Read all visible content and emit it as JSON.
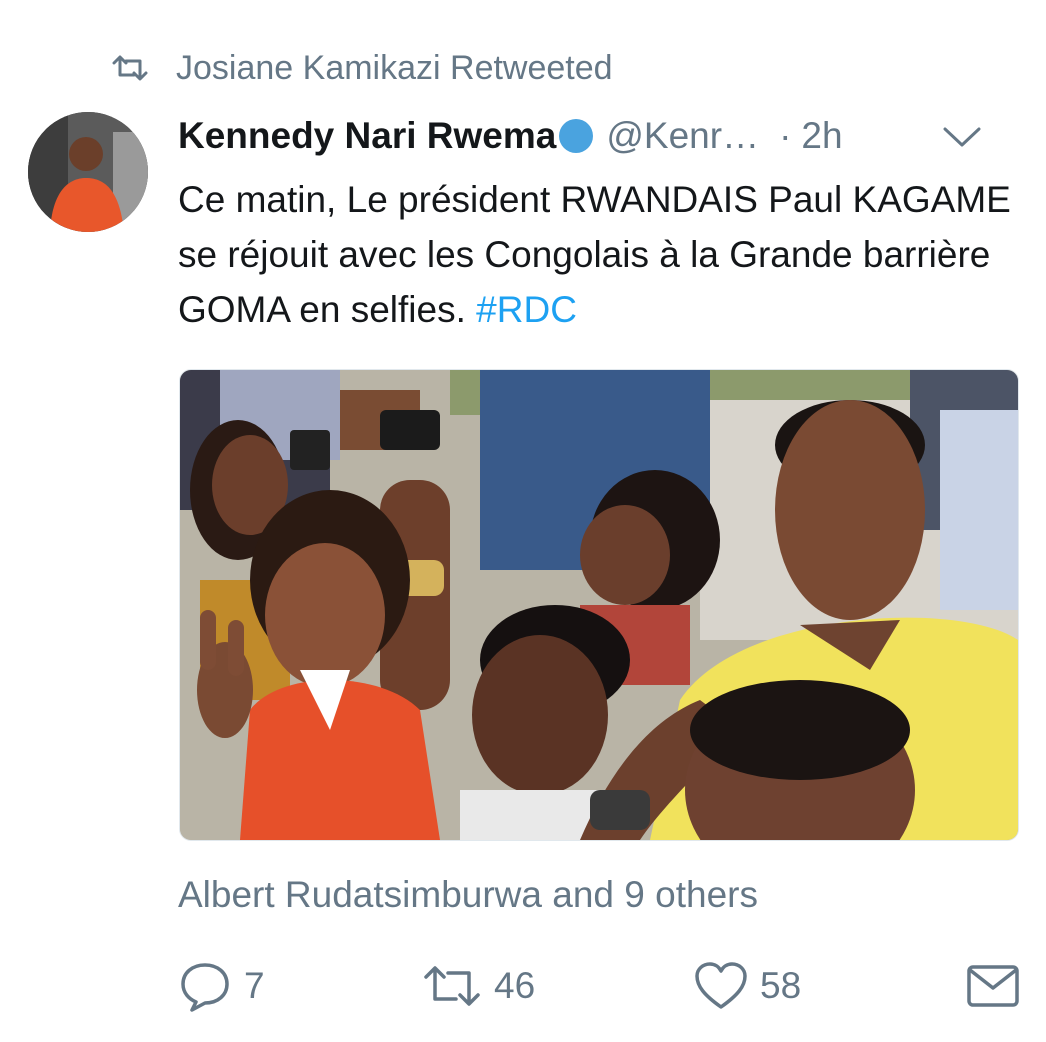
{
  "retweet_notice": {
    "icon": "retweet-icon",
    "text": "Josiane Kamikazi Retweeted"
  },
  "tweet": {
    "display_name": "Kennedy Nari Rwema",
    "verified_icon": "verified-badge-icon",
    "handle": "@Kenr…",
    "separator": "·",
    "time": "2h",
    "menu_icon": "chevron-down-icon",
    "text": "Ce matin, Le président RWANDAIS Paul KAGAME se réjouit avec les Congolais à la Grande barrière GOMA en selfies. ",
    "hashtag": "#RDC",
    "media_icon": "photo",
    "likers": "Albert Rudatsimburwa and 9 others",
    "actions": {
      "reply": {
        "icon": "reply-icon",
        "count": "7"
      },
      "retweet": {
        "icon": "retweet-icon",
        "count": "46"
      },
      "like": {
        "icon": "heart-icon",
        "count": "58"
      },
      "message": {
        "icon": "envelope-icon"
      }
    }
  },
  "colors": {
    "text": "#14171a",
    "secondary": "#657786",
    "link": "#1da1f2",
    "verified": "#4aa3df"
  }
}
